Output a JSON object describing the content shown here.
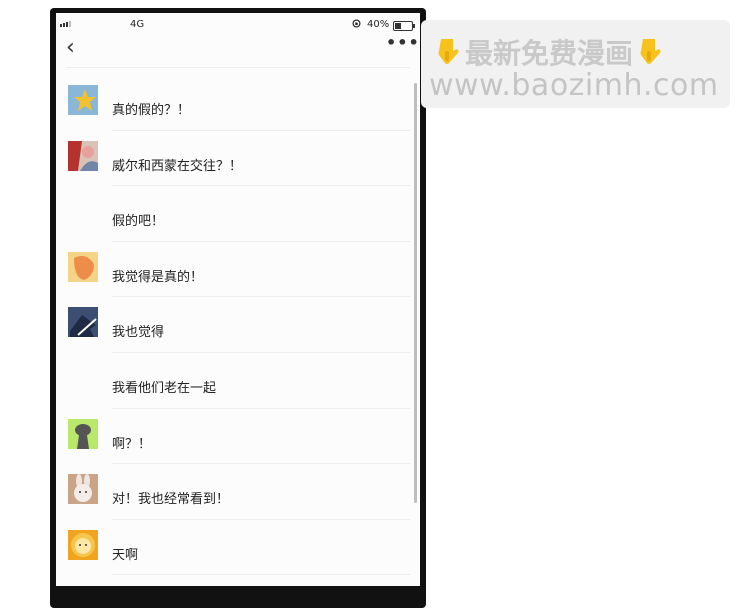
{
  "status_bar": {
    "network": "4G",
    "battery_text": "40%",
    "battery_level": 0.4,
    "icons": [
      "signal-icon",
      "rotation-lock-icon",
      "battery-icon"
    ]
  },
  "nav": {
    "back_icon": "chevron-left-icon",
    "more_icon": "more-dots-icon",
    "back_glyph": "‹",
    "more_glyph": "•••"
  },
  "comments": [
    {
      "avatar": "star-avatar",
      "text": "真的假的？！"
    },
    {
      "avatar": "red-figure-avatar",
      "text": "威尔和西蒙在交往？！"
    },
    {
      "avatar": "",
      "text": "假的吧！"
    },
    {
      "avatar": "orange-face-avatar",
      "text": "我觉得是真的！"
    },
    {
      "avatar": "shark-avatar",
      "text": "我也觉得"
    },
    {
      "avatar": "",
      "text": "我看他们老在一起"
    },
    {
      "avatar": "silhouette-avatar",
      "text": "啊？！"
    },
    {
      "avatar": "rabbit-avatar",
      "text": "对！我也经常看到！"
    },
    {
      "avatar": "lion-avatar",
      "text": "天啊"
    }
  ],
  "watermark": {
    "line1": "最新免费漫画",
    "line2": "www.baozimh.com",
    "icons": [
      "pointing-down-hand-icon",
      "pointing-down-hand-icon"
    ],
    "color": "#c8c8c8"
  }
}
